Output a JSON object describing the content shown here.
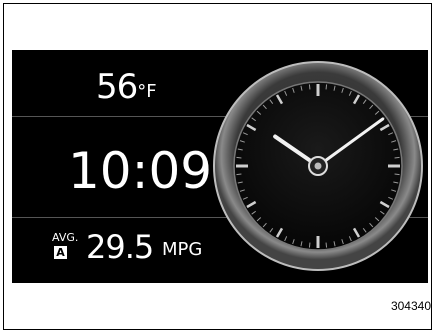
{
  "display": {
    "temperature": {
      "value": "56",
      "unit": "°F"
    },
    "time": "10:09",
    "fuel": {
      "label": "AVG.",
      "mode": "A",
      "value": "29.5",
      "unit": "MPG"
    },
    "analog_clock": {
      "hour": 10,
      "minute": 9
    }
  },
  "figure_code": "304340"
}
